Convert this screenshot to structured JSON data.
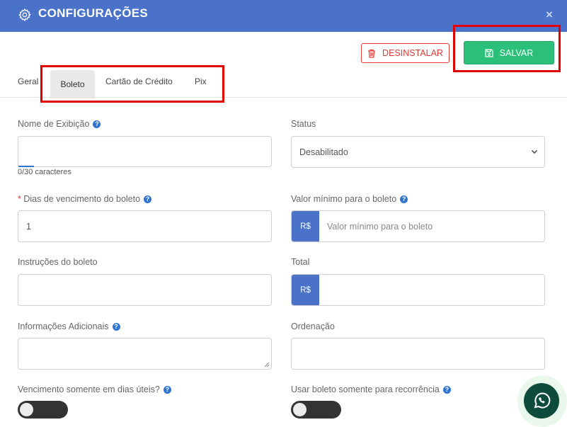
{
  "header": {
    "title": "CONFIGURAÇÕES",
    "close_symbol": "×"
  },
  "toolbar": {
    "uninstall_label": "DESINSTALAR",
    "save_label": "SALVAR"
  },
  "tabs": [
    {
      "label": "Geral",
      "active": false
    },
    {
      "label": "Boleto",
      "active": true
    },
    {
      "label": "Cartão de Crédito",
      "active": false
    },
    {
      "label": "Pix",
      "active": false
    }
  ],
  "form": {
    "display_name": {
      "label": "Nome de Exibição",
      "value": "",
      "counter": "0/30 caracteres"
    },
    "status": {
      "label": "Status",
      "value": "Desabilitado"
    },
    "due_days": {
      "label": "Dias de vencimento do boleto",
      "required_mark": "*",
      "value": "1"
    },
    "min_value": {
      "label": "Valor mínimo para o boleto",
      "prefix": "R$",
      "placeholder": "Valor mínimo para o boleto"
    },
    "instructions": {
      "label": "Instruções do boleto",
      "value": ""
    },
    "total": {
      "label": "Total",
      "prefix": "R$",
      "value": ""
    },
    "additional_info": {
      "label": "Informações Adicionais",
      "value": ""
    },
    "ordering": {
      "label": "Ordenação",
      "value": ""
    },
    "business_days": {
      "label": "Vencimento somente em dias úteis?",
      "enabled": false
    },
    "recurrence_only": {
      "label": "Usar boleto somente para recorrência",
      "enabled": false
    }
  },
  "help_symbol": "?",
  "colors": {
    "header": "#4a72c9",
    "save": "#2bc07a",
    "danger": "#e53935",
    "help": "#2f74d0",
    "highlight": "#e00000"
  }
}
